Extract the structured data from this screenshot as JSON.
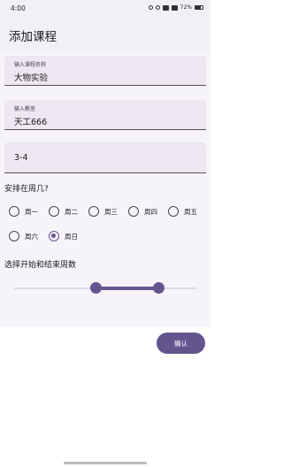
{
  "status": {
    "time": "4:00",
    "battery": "72%"
  },
  "appbar": {
    "title": "添加课程"
  },
  "fields": {
    "course_name": {
      "label": "输入课程名称",
      "value": "大物实验"
    },
    "classroom": {
      "label": "输入教室",
      "value": "天工666"
    },
    "section": {
      "value": "3-4"
    }
  },
  "weekday": {
    "question": "安排在周几?",
    "options": [
      "周一",
      "周二",
      "周三",
      "周四",
      "周五",
      "周六",
      "周日"
    ],
    "selected": "周日"
  },
  "weeks": {
    "label": "选择开始和结束周数"
  },
  "actions": {
    "confirm": "确认"
  },
  "colors": {
    "accent": "#65558f"
  }
}
